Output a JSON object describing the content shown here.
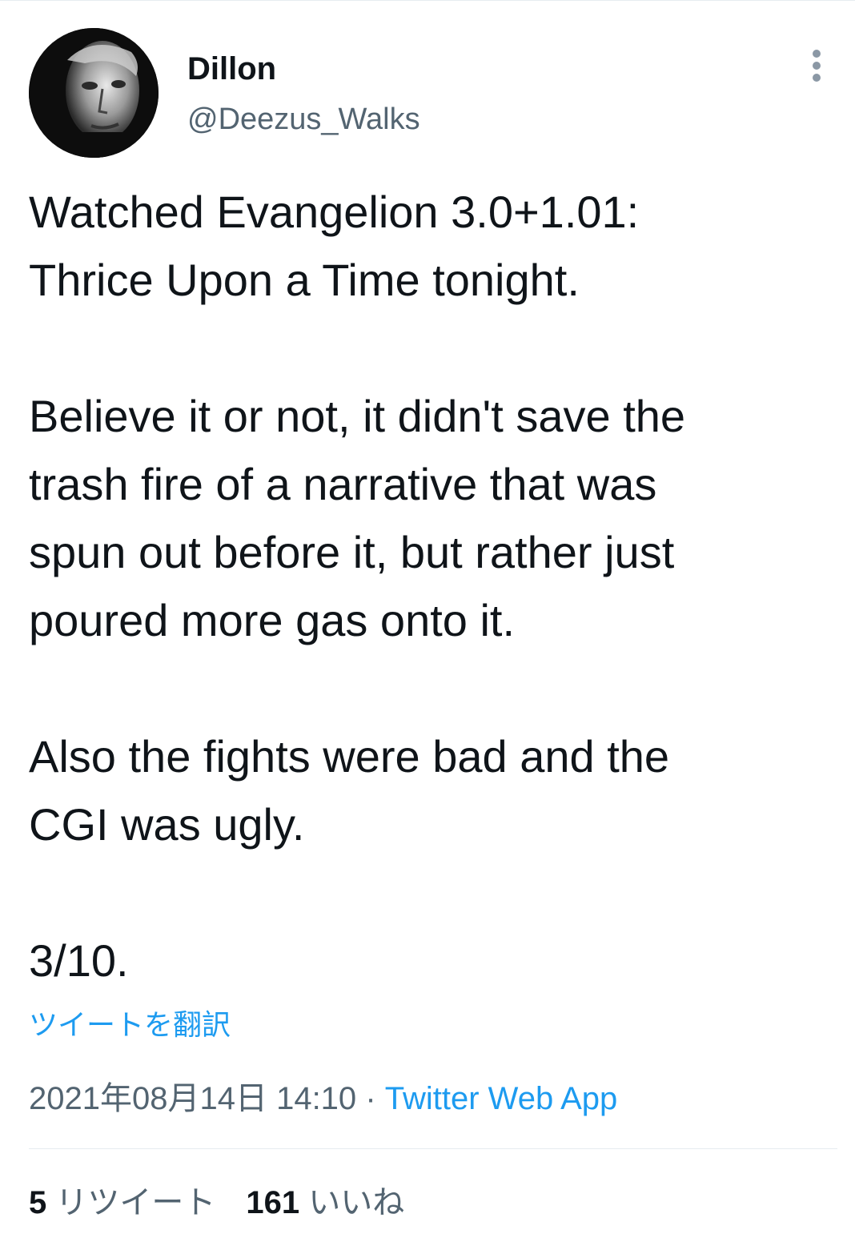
{
  "author": {
    "display_name": "Dillon",
    "handle": "@Deezus_Walks",
    "avatar_icon": "profile-photo"
  },
  "tweet": {
    "paragraphs": [
      [
        "Watched Evangelion 3.0+1.01:",
        "Thrice Upon a Time tonight."
      ],
      [
        "Believe it or not, it didn't save the",
        "trash fire of a narrative that was",
        "spun out before it, but rather just",
        "poured more gas onto it."
      ],
      [
        "Also the fights were bad and the",
        "CGI was ugly."
      ],
      [
        "3/10."
      ]
    ]
  },
  "translate_label": "ツイートを翻訳",
  "meta": {
    "timestamp": "2021年08月14日 14:10",
    "separator": "·",
    "source": "Twitter Web App"
  },
  "stats": {
    "retweets_count": "5",
    "retweets_label": "リツイート",
    "likes_count": "161",
    "likes_label": "いいね"
  },
  "colors": {
    "text": "#0f1419",
    "secondary": "#536471",
    "link": "#1d9bf0",
    "divider": "#e6ecf0"
  },
  "icons": {
    "more": "more-vertical-icon"
  }
}
